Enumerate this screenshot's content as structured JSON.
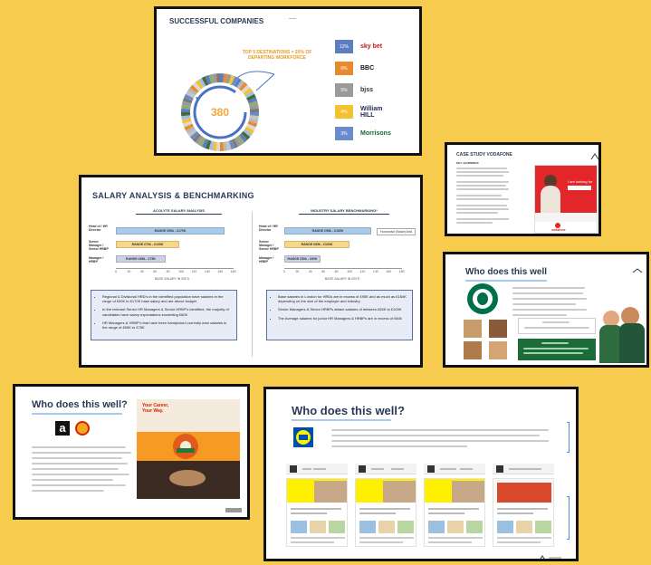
{
  "slide1": {
    "title": "SUCCESSFUL COMPANIES",
    "note": "TOP 5 DESTINATIONS = 20% OF DEPARTING WORKFORCE",
    "center_value": "380",
    "ranks": [
      {
        "pct": "12%",
        "color": "#5B7EC0",
        "logo": "sky bet",
        "logo_color": "#c4161c"
      },
      {
        "pct": "6%",
        "color": "#E88A2E",
        "logo": "BBC",
        "logo_color": "#111111"
      },
      {
        "pct": "5%",
        "color": "#9A9A9A",
        "logo": "bjss",
        "logo_color": "#333333"
      },
      {
        "pct": "4%",
        "color": "#F3C230",
        "logo": "William HILL",
        "logo_color": "#1d2a55"
      },
      {
        "pct": "3%",
        "color": "#6A8CCB",
        "logo": "Morrisons",
        "logo_color": "#0f6b37"
      }
    ]
  },
  "slide2": {
    "title": "SALARY ANALYSIS & BENCHMARKING",
    "left_header": "ACOLYTE SALARY ANALYSIS",
    "right_header": "INDUSTRY SALARY BENCHMARKING*",
    "categories": [
      "Head of / HR Director",
      "Senior Manager / Senior HRBP",
      "Manager / HRBP"
    ],
    "left_bars": [
      "RANGE £90k - £170K",
      "RANGE £70k - £100K",
      "RANGE £65k - £75K"
    ],
    "right_bars": [
      "RANGE £95k - £160K",
      "RANGE £65k - £100K",
      "RANGE £50k - £60K"
    ],
    "axis_ticks": [
      "0",
      "20",
      "40",
      "60",
      "80",
      "100",
      "120",
      "140",
      "160",
      "180"
    ],
    "axis_label": "BASE SALARY IN 000'S",
    "tooltip": "Horizontal (Value) Axis",
    "left_bullets": [
      "Regional & Divisional HRD's in the identified population have salaries in the range of £90K to £170K base salary and are above budget",
      "In the relevant Senior HR Managers & Senior HRBP's identified, the majority of candidates have salary expectations exceeding £80K",
      "HR Managers & HRBP's that have been handpicked currently earn salaries in the range of £65K to £75K"
    ],
    "right_bullets": [
      "Base salaries in London for HRDs are in excess of £95K and as much as £160K depending on the size of the employer and industry",
      "Senior Managers & Senior HRBPs attract salaries of between £65K to £100K",
      "The Average salaries for junior HR Managers & HRBPs are in excess of £60k"
    ]
  },
  "slide3": {
    "title": "CASE STUDY VODAFONE",
    "subtitle": "KEY LEARNINGS",
    "screen_text": "I am looking for",
    "brand": "vodafone"
  },
  "slide4": {
    "title": "Who does this well"
  },
  "slide5": {
    "title": "Who does this well?",
    "banner": "Your Career, Your Way."
  },
  "slide6": {
    "title": "Who does this well?"
  }
}
